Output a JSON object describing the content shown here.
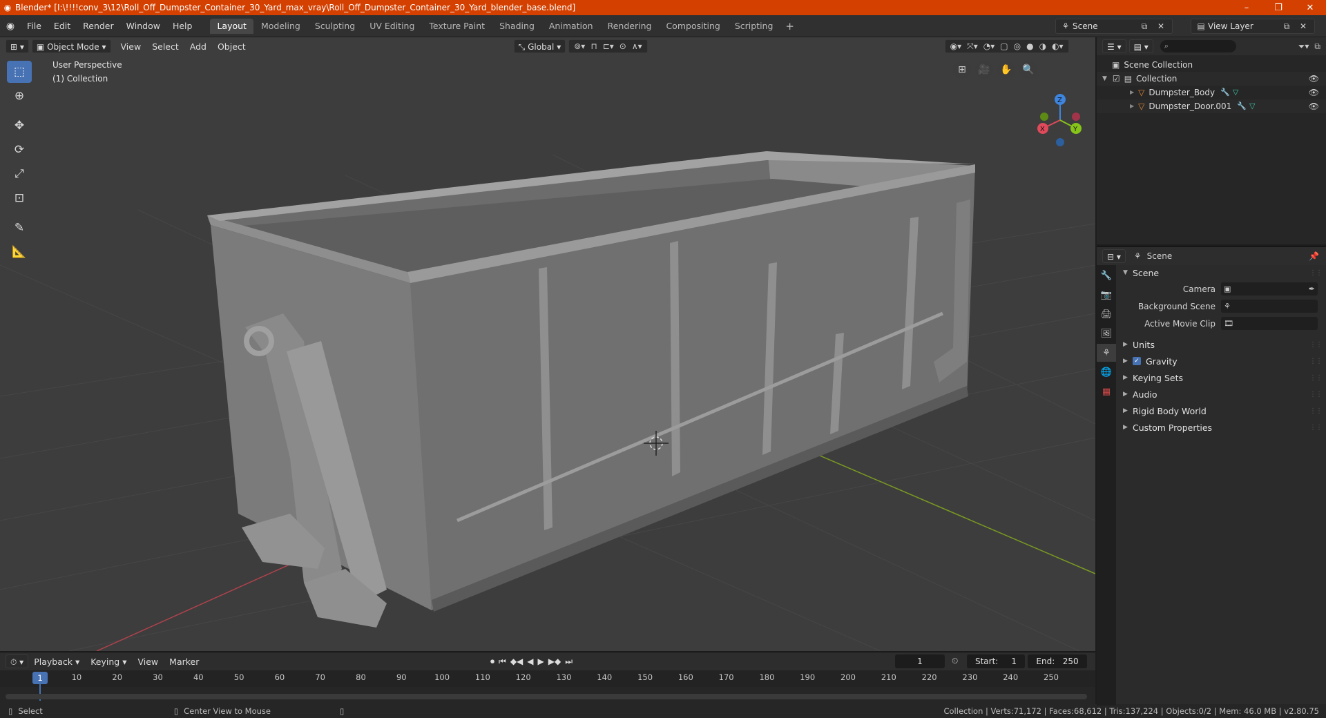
{
  "window": {
    "title": "Blender* [I:\\!!!!conv_3\\12\\Roll_Off_Dumpster_Container_30_Yard_max_vray\\Roll_Off_Dumpster_Container_30_Yard_blender_base.blend]",
    "minimize": "–",
    "maximize": "❐",
    "close": "✕"
  },
  "menubar": {
    "menus": [
      "File",
      "Edit",
      "Render",
      "Window",
      "Help"
    ],
    "workspaces": [
      "Layout",
      "Modeling",
      "Sculpting",
      "UV Editing",
      "Texture Paint",
      "Shading",
      "Animation",
      "Rendering",
      "Compositing",
      "Scripting"
    ],
    "active_workspace": "Layout",
    "add_tab": "+",
    "scene_name": "Scene",
    "view_layer": "View Layer"
  },
  "viewport": {
    "mode": "Object Mode",
    "menus": [
      "View",
      "Select",
      "Add",
      "Object"
    ],
    "orientation": "Global",
    "overlay_title": "User Perspective",
    "overlay_collection": "(1) Collection",
    "axis_labels": {
      "x": "X",
      "y": "Y",
      "z": "Z"
    },
    "colors": {
      "axis_x": "#e04a5a",
      "axis_y": "#86c41a",
      "axis_z": "#3e85df",
      "background": "#3d3d3d"
    }
  },
  "timeline": {
    "menus": [
      "Playback",
      "Keying",
      "View",
      "Marker"
    ],
    "current_frame": "1",
    "start_label": "Start:",
    "start": "1",
    "end_label": "End:",
    "end": "250",
    "ticks": [
      "1",
      "10",
      "20",
      "30",
      "40",
      "50",
      "60",
      "70",
      "80",
      "90",
      "100",
      "110",
      "120",
      "130",
      "140",
      "150",
      "160",
      "170",
      "180",
      "190",
      "200",
      "210",
      "220",
      "230",
      "240",
      "250"
    ]
  },
  "statusbar": {
    "select": "Select",
    "center_view": "Center View to Mouse",
    "stats": "Collection | Verts:71,172 | Faces:68,612 | Tris:137,224 | Objects:0/2 | Mem: 46.0 MB | v2.80.75"
  },
  "outliner": {
    "scene_collection": "Scene Collection",
    "collection": "Collection",
    "objects": [
      "Dumpster_Body",
      "Dumpster_Door.001"
    ]
  },
  "properties": {
    "context": "Scene",
    "panel": "Scene",
    "camera_label": "Camera",
    "background_scene_label": "Background Scene",
    "active_movie_clip_label": "Active Movie Clip",
    "subpanels": [
      "Units",
      "Gravity",
      "Keying Sets",
      "Audio",
      "Rigid Body World",
      "Custom Properties"
    ],
    "gravity_checked": true
  }
}
